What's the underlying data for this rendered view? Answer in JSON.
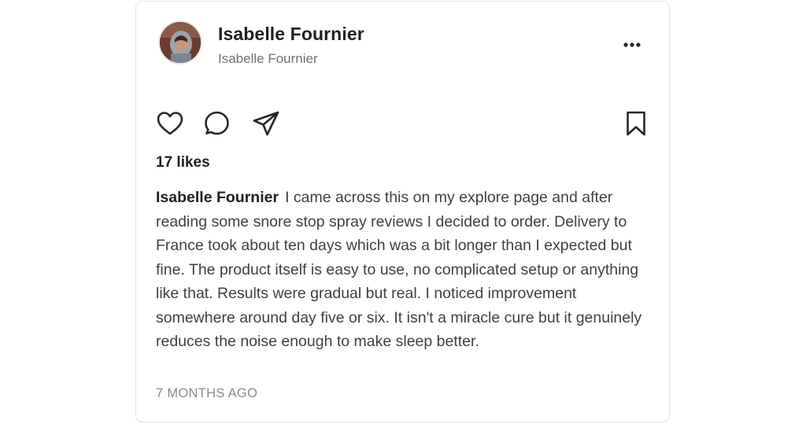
{
  "post": {
    "author": {
      "name": "Isabelle Fournier",
      "subtitle": "Isabelle Fournier"
    },
    "likes_text": "17 likes",
    "caption": {
      "author": "Isabelle Fournier",
      "text": "I came across this on my explore page and after reading some snore stop spray reviews I decided to order. Delivery to France took about ten days which was a bit longer than I expected but fine. The product itself is easy to use, no complicated setup or anything like that. Results were gradual but real. I noticed improvement somewhere around day five or six. It isn't a miracle cure but it genuinely reduces the noise enough to make sleep better."
    },
    "timestamp": "7 MONTHS AGO"
  },
  "icons": {
    "more": "more-horizontal-icon",
    "like": "heart-icon",
    "comment": "comment-bubble-icon",
    "share": "send-icon",
    "save": "bookmark-icon"
  },
  "colors": {
    "text_primary": "#1f1f24",
    "text_body": "#3f3f46",
    "text_muted": "#8a8a92",
    "border": "#e3e3e6"
  }
}
